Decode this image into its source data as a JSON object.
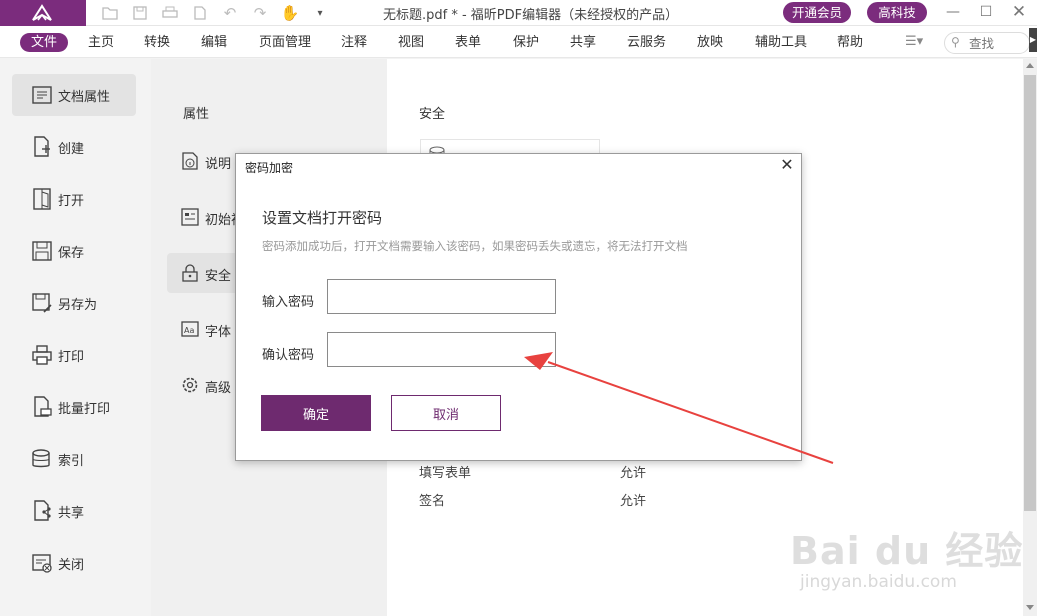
{
  "window": {
    "title": "无标题.pdf * - 福昕PDF编辑器（未经授权的产品）",
    "vip_button": "开通会员",
    "user_button": "高科技"
  },
  "menu": {
    "items": [
      "文件",
      "主页",
      "转换",
      "编辑",
      "页面管理",
      "注释",
      "视图",
      "表单",
      "保护",
      "共享",
      "云服务",
      "放映",
      "辅助工具",
      "帮助"
    ],
    "active_index": 0,
    "search_placeholder": "查找"
  },
  "sidebar": {
    "items": [
      {
        "label": "文档属性",
        "icon": "document-properties-icon",
        "active": true
      },
      {
        "label": "创建",
        "icon": "create-document-icon",
        "active": false
      },
      {
        "label": "打开",
        "icon": "open-document-icon",
        "active": false
      },
      {
        "label": "保存",
        "icon": "save-icon",
        "active": false
      },
      {
        "label": "另存为",
        "icon": "save-as-icon",
        "active": false
      },
      {
        "label": "打印",
        "icon": "print-icon",
        "active": false
      },
      {
        "label": "批量打印",
        "icon": "batch-print-icon",
        "active": false
      },
      {
        "label": "索引",
        "icon": "index-icon",
        "active": false
      },
      {
        "label": "共享",
        "icon": "share-icon",
        "active": false
      },
      {
        "label": "关闭",
        "icon": "close-document-icon",
        "active": false
      }
    ]
  },
  "properties_panel": {
    "title": "属性",
    "items": [
      {
        "label": "说明",
        "icon": "info-icon",
        "active": false
      },
      {
        "label": "初始视",
        "icon": "initial-view-icon",
        "active": false
      },
      {
        "label": "安全",
        "icon": "lock-icon",
        "active": true
      },
      {
        "label": "字体",
        "icon": "font-icon",
        "active": false
      },
      {
        "label": "高级",
        "icon": "settings-icon",
        "active": false
      }
    ]
  },
  "content": {
    "title": "安全",
    "permissions": [
      {
        "name": "填写表单",
        "value": "允许"
      },
      {
        "name": "签名",
        "value": "允许"
      }
    ]
  },
  "dialog": {
    "title": "密码加密",
    "heading": "设置文档打开密码",
    "description": "密码添加成功后，打开文档需要输入该密码，如果密码丢失或遗忘，将无法打开文档",
    "password_label": "输入密码",
    "confirm_label": "确认密码",
    "password_value": "",
    "confirm_value": "",
    "ok_label": "确定",
    "cancel_label": "取消"
  },
  "watermark": {
    "main": "Bai du 经验",
    "sub": "jingyan.baidu.com"
  },
  "colors": {
    "brand": "#7b2c7d",
    "annotation_arrow": "#e8423f"
  }
}
